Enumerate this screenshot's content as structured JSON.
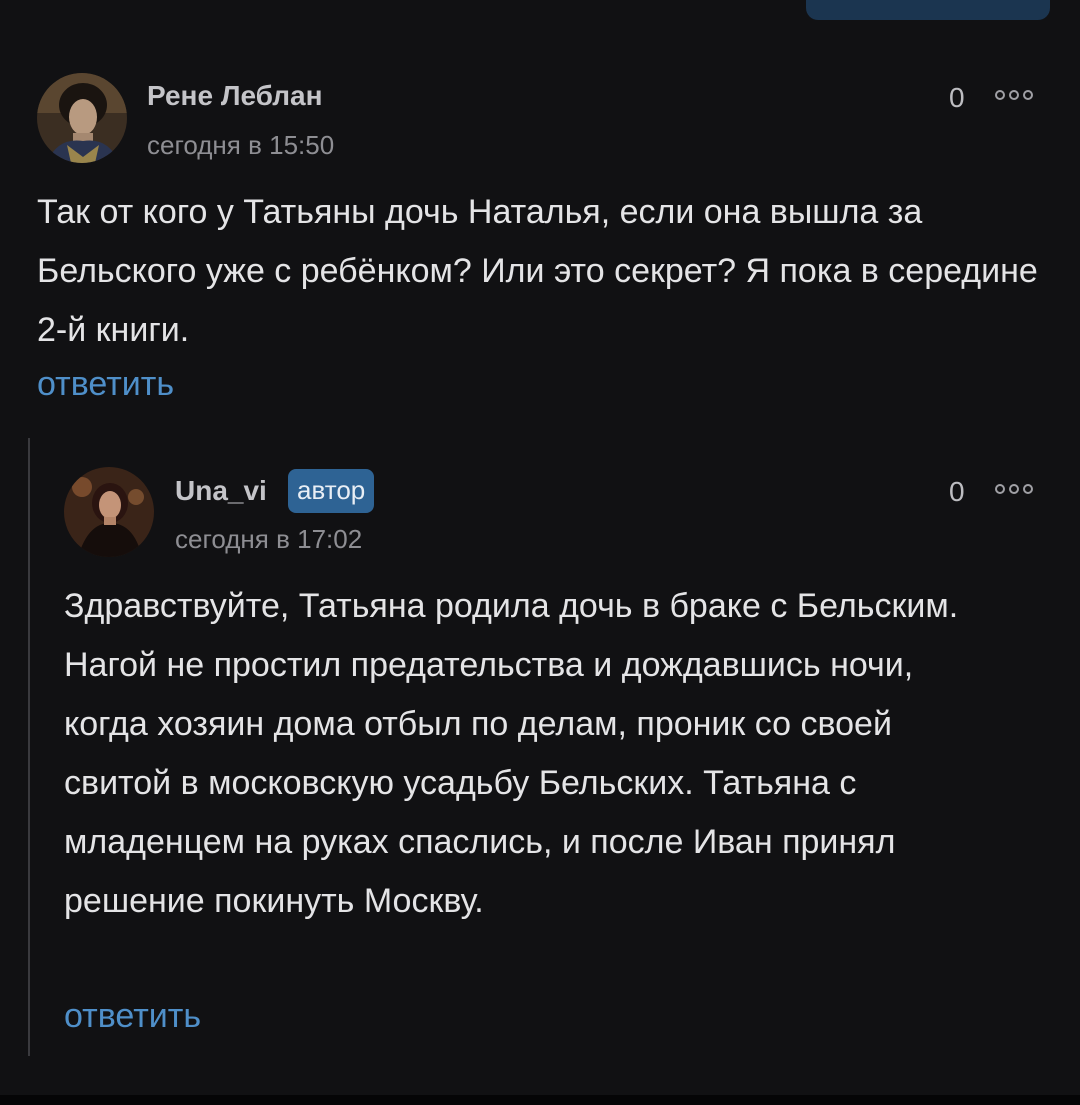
{
  "comments": [
    {
      "author": "Рене Леблан",
      "timestamp": "сегодня в 15:50",
      "score": "0",
      "text": "Так от кого у Татьяны дочь Наталья, если она вышла за Бельского уже с ребёнком? Или это секрет? Я пока в середине 2-й книги.",
      "reply_label": "ответить"
    },
    {
      "author": "Una_vi",
      "badge": "автор",
      "timestamp": "сегодня в 17:02",
      "score": "0",
      "text": "Здравствуйте, Татьяна родила дочь в браке с Бельским. Нагой не простил предательства и дождавшись ночи, когда хозяин дома отбыл по делам, проник со своей свитой в московскую усадьбу Бельских. Татьяна с младенцем на руках спаслись, и после Иван принял решение покинуть Москву.",
      "reply_label": "ответить"
    }
  ],
  "colors": {
    "background": "#111113",
    "link": "#4f8fc9",
    "badge": "#2e6394",
    "text": "#e4e4e6",
    "muted": "#8e8e93"
  },
  "icons": [
    "more-options-icon",
    "avatar-rene",
    "avatar-una-vi"
  ]
}
